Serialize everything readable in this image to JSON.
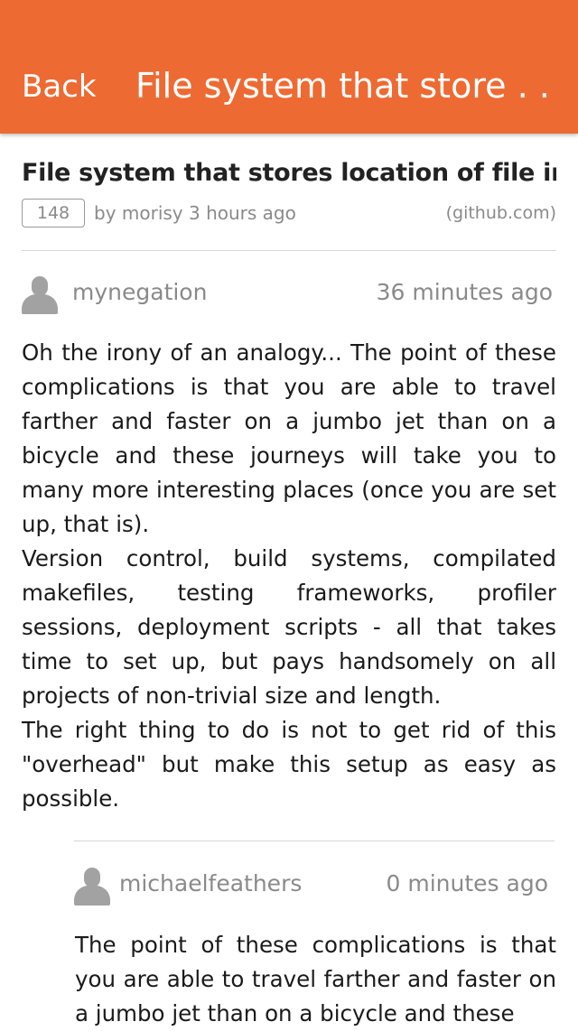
{
  "navbar": {
    "back_label": "Back",
    "title": "File system that store . . ."
  },
  "story": {
    "title": "File system that stores location of file in Pi",
    "points": "148",
    "byline": "by morisy 3 hours ago",
    "domain": "(github.com)"
  },
  "comments": [
    {
      "author": "mynegation",
      "time": "36 minutes ago",
      "paragraphs": [
        "Oh the irony of an analogy... The point of these complications is that you are able to travel farther and faster on a jumbo jet than on a bicycle and these journeys will take you to many more interesting places (once you are set up, that is).",
        "Version control, build systems, compilated makefiles, testing frameworks, profiler sessions, deployment scripts - all that takes time to set up, but pays handsomely on all projects of non-trivial size and length.",
        "The right thing to do is not to get rid of this \"overhead\" but make this setup as easy as possible."
      ]
    },
    {
      "author": "michaelfeathers",
      "time": "0 minutes ago",
      "paragraphs": [
        "The point of these complications is that you are able to travel farther and faster on a jumbo jet than on a bicycle and these"
      ]
    }
  ],
  "colors": {
    "navbar": "#ee6a33",
    "meta_text": "#8a8a8a",
    "avatar": "#a2a2a2"
  }
}
